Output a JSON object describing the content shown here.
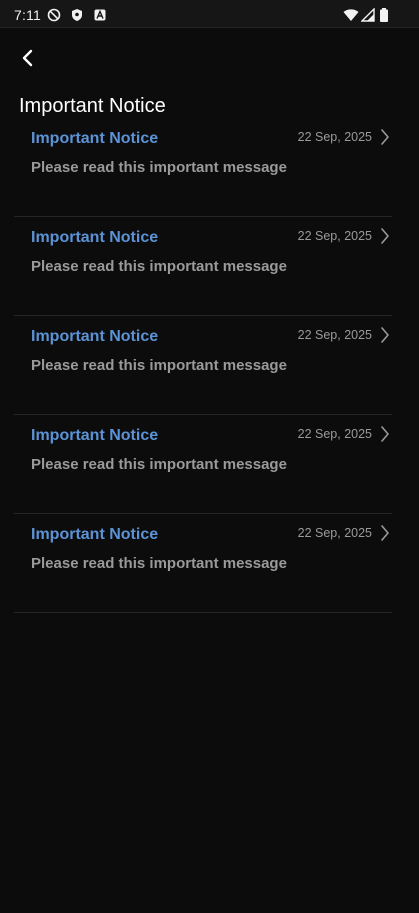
{
  "status_bar": {
    "time": "7:11",
    "left_icons": [
      "do-not-disturb-icon",
      "shield-icon",
      "app-notification-icon"
    ],
    "right_icons": [
      "wifi-icon",
      "cellular-signal-icon",
      "battery-icon"
    ]
  },
  "header": {
    "back_icon": "chevron-left-icon",
    "title": "Important Notice"
  },
  "notices": [
    {
      "title": "Important Notice",
      "message": "Please read this important message",
      "date": "22 Sep, 2025"
    },
    {
      "title": "Important Notice",
      "message": "Please read this important message",
      "date": "22 Sep, 2025"
    },
    {
      "title": "Important Notice",
      "message": "Please read this important message",
      "date": "22 Sep, 2025"
    },
    {
      "title": "Important Notice",
      "message": "Please read this important message",
      "date": "22 Sep, 2025"
    },
    {
      "title": "Important Notice",
      "message": "Please read this important message",
      "date": "22 Sep, 2025"
    }
  ],
  "colors": {
    "background": "#0c0c0c",
    "accent_title": "#5b93d6",
    "secondary_text": "#9a9a9a",
    "divider": "#262626"
  }
}
